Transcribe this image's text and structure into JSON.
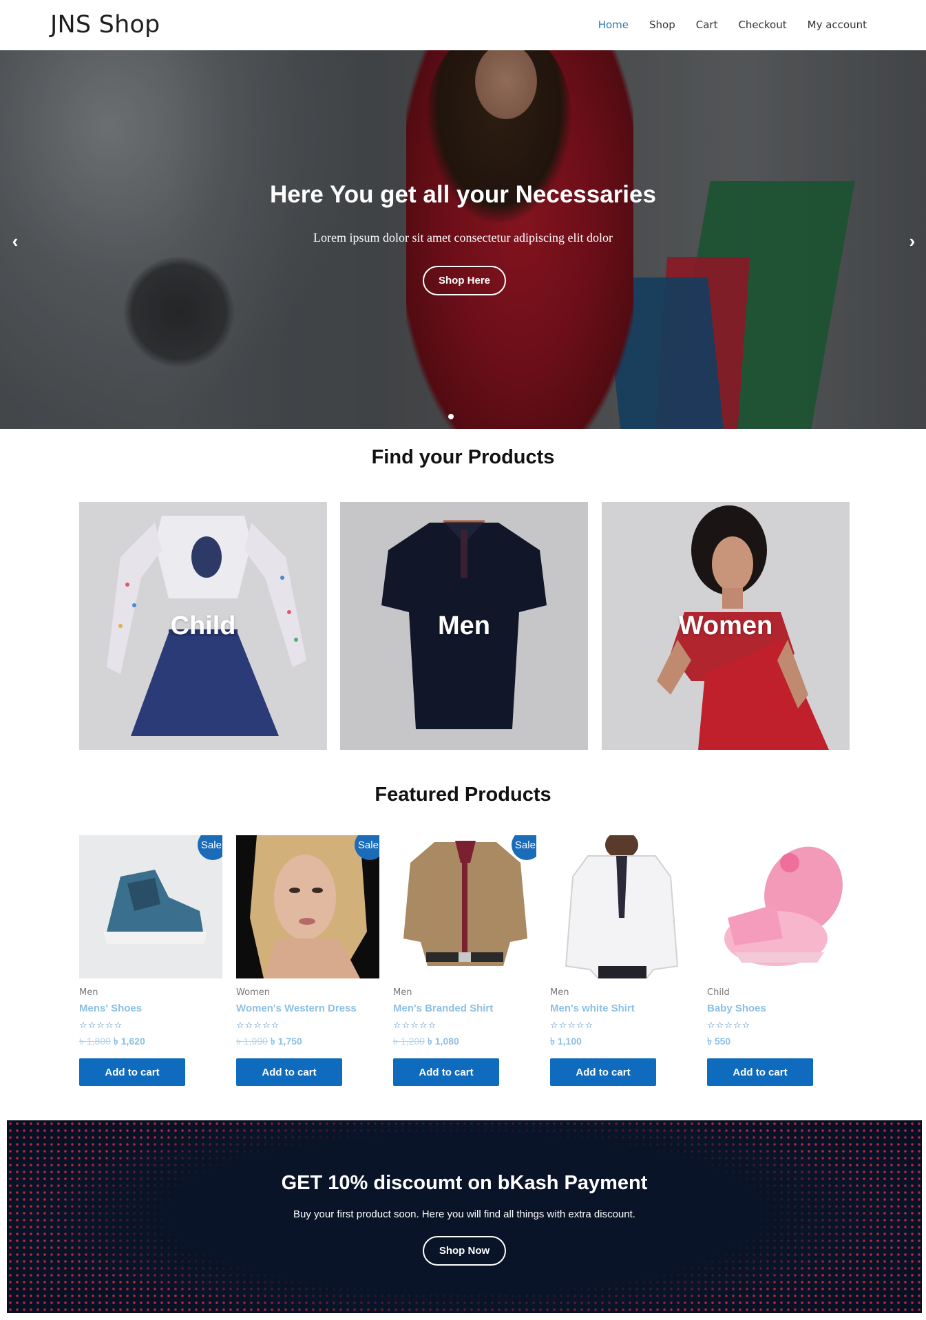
{
  "header": {
    "logo": "JNS Shop",
    "nav": [
      "Home",
      "Shop",
      "Cart",
      "Checkout",
      "My account"
    ],
    "active": "Home"
  },
  "hero": {
    "title": "Here You get all your Necessaries",
    "subtitle": "Lorem ipsum dolor sit amet consectetur adipiscing elit dolor",
    "button": "Shop Here",
    "prev_icon": "chevron-left-icon",
    "next_icon": "chevron-right-icon"
  },
  "find": {
    "title": "Find your Products",
    "categories": [
      "Child",
      "Men",
      "Women"
    ]
  },
  "featured": {
    "title": "Featured Products",
    "products": [
      {
        "category": "Men",
        "name": "Mens' Shoes",
        "rating": "☆☆☆☆☆",
        "old_price": "৳ 1,800",
        "price": "৳ 1,620",
        "sale": "Sale!",
        "button": "Add to cart"
      },
      {
        "category": "Women",
        "name": "Women's Western Dress",
        "rating": "☆☆☆☆☆",
        "old_price": "৳ 1,990",
        "price": "৳ 1,750",
        "sale": "Sale!",
        "button": "Add to cart"
      },
      {
        "category": "Men",
        "name": "Men's Branded Shirt",
        "rating": "☆☆☆☆☆",
        "old_price": "৳ 1,200",
        "price": "৳ 1,080",
        "sale": "Sale!",
        "button": "Add to cart"
      },
      {
        "category": "Men",
        "name": "Men's white Shirt",
        "rating": "☆☆☆☆☆",
        "old_price": "",
        "price": "৳ 1,100",
        "sale": "",
        "button": "Add to cart"
      },
      {
        "category": "Child",
        "name": "Baby Shoes",
        "rating": "☆☆☆☆☆",
        "old_price": "",
        "price": "৳ 550",
        "sale": "",
        "button": "Add to cart"
      }
    ]
  },
  "promo": {
    "title": "GET 10% discoumt on bKash Payment",
    "text": "Buy your first product soon. Here you will find all things with extra discount.",
    "button": "Shop Now"
  },
  "colors": {
    "accent": "#0f6bbd",
    "nav_active": "#2a7ab0",
    "promo_bg": "#0a1428"
  }
}
